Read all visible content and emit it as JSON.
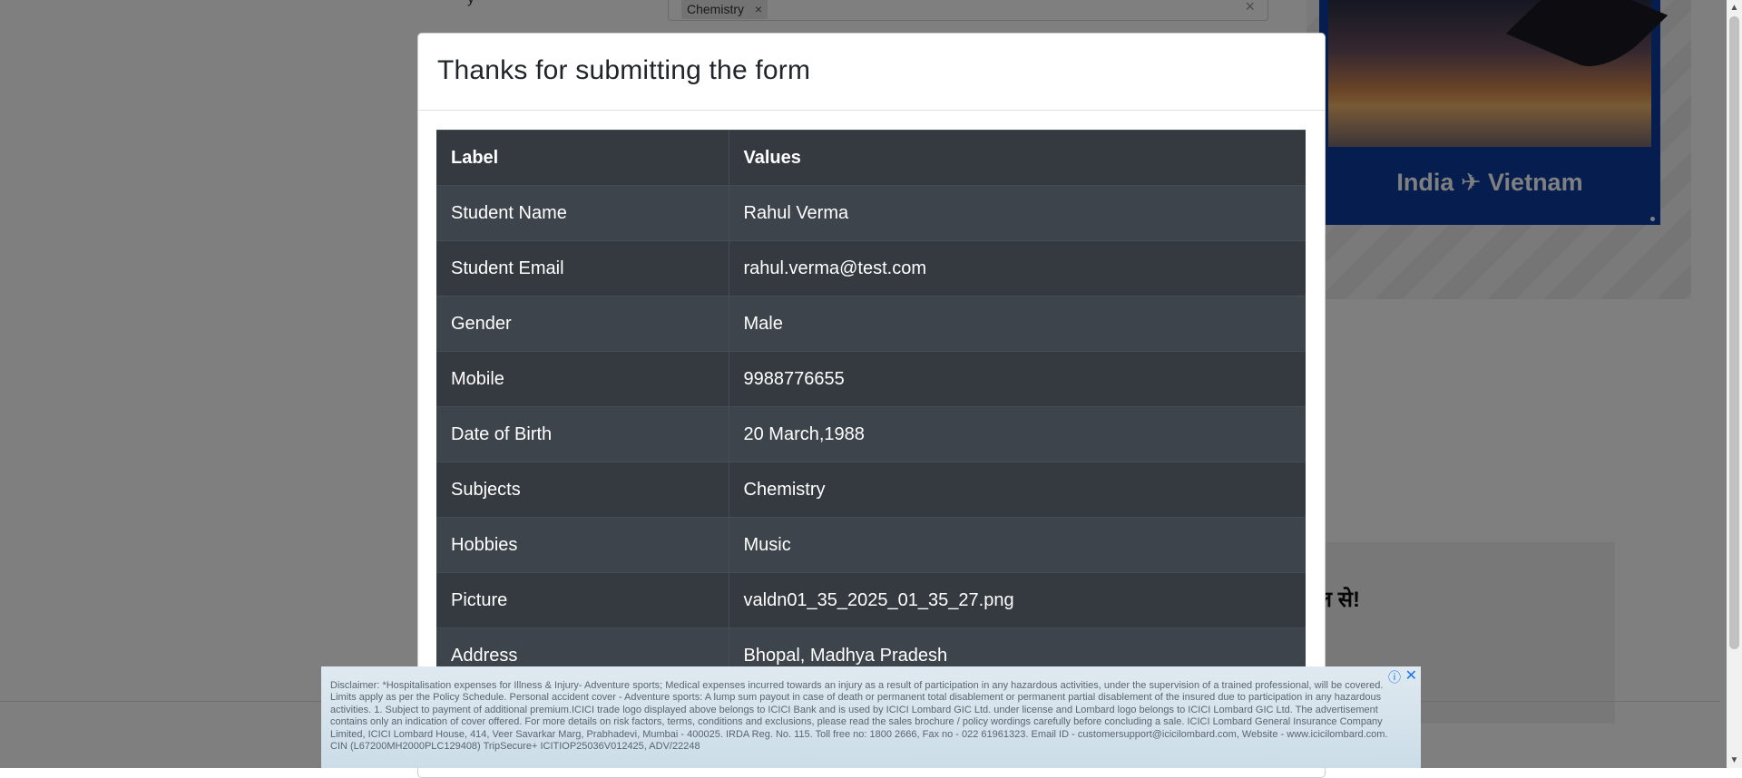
{
  "background_page": {
    "subjects_tag": "Chemistry",
    "tag_remove": "×",
    "clear_all": "×",
    "side_ad_text": "India ✈ Vietnam",
    "side_hindi_text": "इल से!"
  },
  "modal": {
    "title": "Thanks for submitting the form",
    "table": {
      "headers": [
        "Label",
        "Values"
      ],
      "rows": [
        {
          "label": "Student Name",
          "value": "Rahul Verma"
        },
        {
          "label": "Student Email",
          "value": "rahul.verma@test.com"
        },
        {
          "label": "Gender",
          "value": "Male"
        },
        {
          "label": "Mobile",
          "value": "9988776655"
        },
        {
          "label": "Date of Birth",
          "value": "20 March,1988"
        },
        {
          "label": "Subjects",
          "value": "Chemistry"
        },
        {
          "label": "Hobbies",
          "value": "Music"
        },
        {
          "label": "Picture",
          "value": "valdn01_35_2025_01_35_27.png"
        },
        {
          "label": "Address",
          "value": "Bhopal, Madhya Pradesh"
        }
      ]
    }
  },
  "ad_banner": {
    "info_icon": "ⓘ",
    "close_icon": "✕",
    "disclaimer": "Disclaimer: *Hospitalisation expenses for Illness & Injury- Adventure sports; Medical expenses incurred towards an injury as a result of participation in any hazardous activities, under the supervision of a trained professional, will be covered. Limits apply as per the Policy Schedule. Personal accident cover - Adventure sports: A lump sum payout in case of death or permanent total disablement or permanent partial disablement of the insured due to participation in any hazardous activities. 1. Subject to payment of additional premium.ICICI trade logo displayed above belongs to ICICI Bank and is used by ICICI Lombard GIC Ltd. under license and Lombard logo belongs to ICICI Lombard GIC Ltd. The advertisement contains only an indication of cover offered. For more details on risk factors, terms, conditions and exclusions, please read the sales brochure / policy wordings carefully before concluding a sale. ICICI Lombard General Insurance Company Limited, ICICI Lombard House, 414, Veer Savarkar Marg, Prabhadevi, Mumbai - 400025. IRDA Reg. No. 115. Toll free no: 1800 2666, Fax no - 022 61961323. Email ID - customersupport@icicilombard.com, Website - www.icicilombard.com. CIN (L67200MH2000PLC129408) TripSecure+ ICITIOP25036V012425, ADV/22248"
  },
  "scrollbar": {
    "up_arrow": "▲",
    "down_arrow": "▼"
  }
}
